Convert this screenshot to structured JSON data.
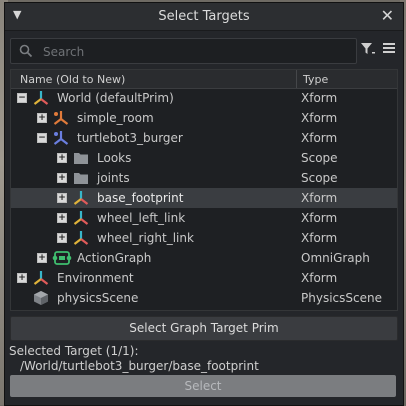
{
  "dialog": {
    "title": "Select Targets"
  },
  "search": {
    "placeholder": "Search"
  },
  "tree": {
    "header_name": "Name (Old to New)",
    "header_type": "Type",
    "rows": [
      {
        "label": "World (defaultPrim)",
        "type": "Xform",
        "expander": "−",
        "icon": "xform-icon"
      },
      {
        "label": "simple_room",
        "type": "Xform",
        "expander": "+",
        "icon": "xform-icon"
      },
      {
        "label": "turtlebot3_burger",
        "type": "Xform",
        "expander": "−",
        "icon": "xform-icon"
      },
      {
        "label": "Looks",
        "type": "Scope",
        "expander": "+",
        "icon": "folder-icon"
      },
      {
        "label": "joints",
        "type": "Scope",
        "expander": "+",
        "icon": "folder-icon"
      },
      {
        "label": "base_footprint",
        "type": "Xform",
        "expander": "+",
        "icon": "xform-icon",
        "selected": true
      },
      {
        "label": "wheel_left_link",
        "type": "Xform",
        "expander": "+",
        "icon": "xform-icon"
      },
      {
        "label": "wheel_right_link",
        "type": "Xform",
        "expander": "+",
        "icon": "xform-icon"
      },
      {
        "label": "ActionGraph",
        "type": "OmniGraph",
        "expander": "+",
        "icon": "omnigraph-icon"
      },
      {
        "label": "Environment",
        "type": "Xform",
        "expander": "+",
        "icon": "xform-icon"
      },
      {
        "label": "physicsScene",
        "type": "PhysicsScene",
        "expander": "",
        "icon": "physics-scene-icon"
      }
    ]
  },
  "buttons": {
    "graph_target": "Select Graph Target Prim",
    "select": "Select"
  },
  "selection": {
    "label": "Selected Target (1/1):",
    "path": "/World/turtlebot3_burger/base_footprint"
  }
}
